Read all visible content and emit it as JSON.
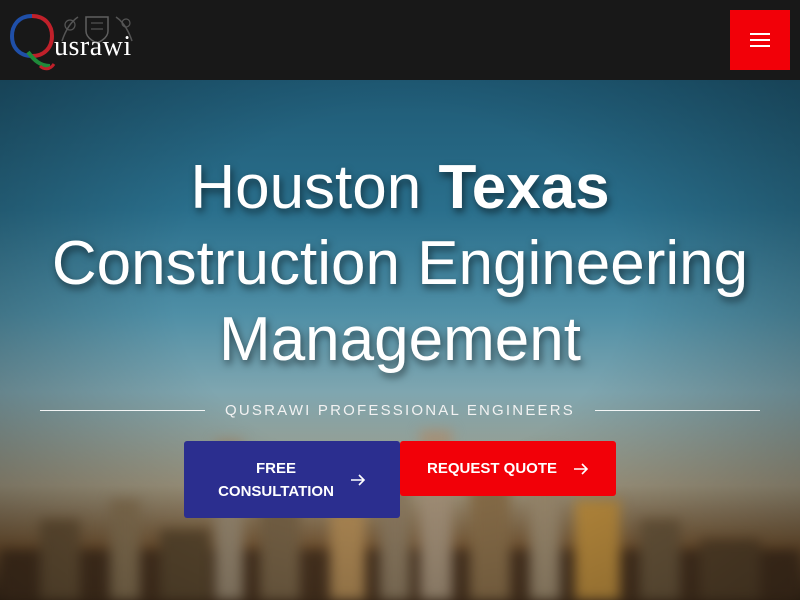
{
  "header": {
    "logo_text": "usrawi",
    "logo_initial": "Q",
    "logo_alt": "Qusrawi",
    "menu_icon": "hamburger-menu-icon",
    "menu_color": "#f20008"
  },
  "hero": {
    "title_line1_regular": "Houston ",
    "title_line1_bold": "Texas",
    "title_line2": "Construction Engineering",
    "title_line3": "Management",
    "tagline": "QUSRAWI PROFESSIONAL ENGINEERS",
    "buttons": [
      {
        "label_line1": "FREE",
        "label_line2": "CONSULTATION",
        "icon": "arrow-right-icon",
        "color": "#2b2e8f"
      },
      {
        "label": "REQUEST QUOTE",
        "icon": "arrow-right-icon",
        "color": "#f20008"
      }
    ]
  }
}
